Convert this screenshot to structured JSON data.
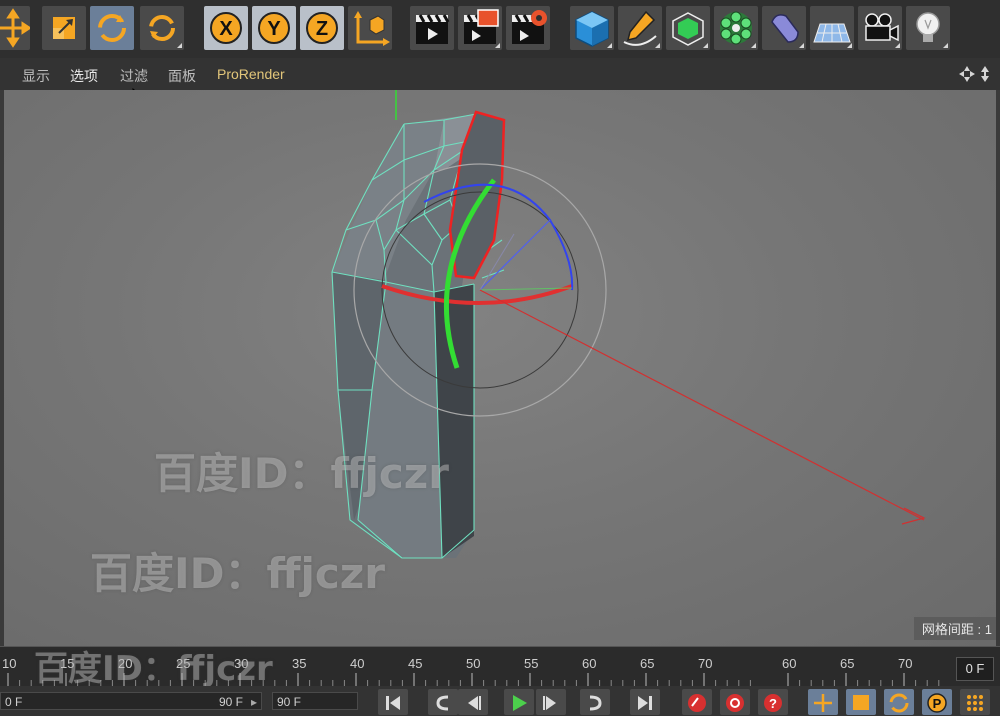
{
  "toolbar": {
    "buttons": [
      {
        "name": "move-tool",
        "icon": "move-arrows-icon"
      },
      {
        "name": "scale-tool",
        "icon": "scale-icon"
      },
      {
        "name": "rotate-tool",
        "icon": "rotate-icon",
        "active": true
      },
      {
        "name": "recent-tools",
        "icon": "recent-rotate-icon"
      },
      {
        "name": "x-axis",
        "label": "X"
      },
      {
        "name": "y-axis",
        "label": "Y"
      },
      {
        "name": "z-axis",
        "label": "Z"
      },
      {
        "name": "coordinate-system",
        "icon": "coordinate-system-icon"
      },
      {
        "name": "render-view",
        "icon": "clapper-icon"
      },
      {
        "name": "render-region",
        "icon": "clapper-region-icon"
      },
      {
        "name": "render-settings",
        "icon": "clapper-gear-icon"
      },
      {
        "name": "cube",
        "icon": "cube-icon"
      },
      {
        "name": "pen-spline",
        "icon": "pen-icon"
      },
      {
        "name": "subdivision",
        "icon": "subdivision-cube-icon"
      },
      {
        "name": "cloner",
        "icon": "cloner-icon"
      },
      {
        "name": "deformer",
        "icon": "deformer-icon"
      },
      {
        "name": "floor",
        "icon": "floor-icon"
      },
      {
        "name": "camera",
        "icon": "camera-icon"
      },
      {
        "name": "light",
        "icon": "light-bulb-icon"
      }
    ]
  },
  "menu": {
    "items": [
      "显示",
      "选项",
      "过滤",
      "面板",
      "ProRender"
    ]
  },
  "viewport": {
    "grid_spacing_label": "网格间距 : 1"
  },
  "watermark": "百度ID：ffjczr",
  "timeline": {
    "ticks": [
      "10",
      "15",
      "20",
      "25",
      "30",
      "35",
      "40",
      "45",
      "50",
      "55",
      "60",
      "65",
      "70",
      "60",
      "65",
      "70"
    ],
    "current_frame": "0 F"
  },
  "transport": {
    "start_frame": "0 F",
    "end_frame": "90 F",
    "max_frame": "90 F"
  },
  "colors": {
    "accent_orange": "#f5a623",
    "x_axis": "#e03030",
    "y_axis": "#33dd33",
    "z_axis": "#3344ee",
    "wire": "#6fe0c0"
  }
}
